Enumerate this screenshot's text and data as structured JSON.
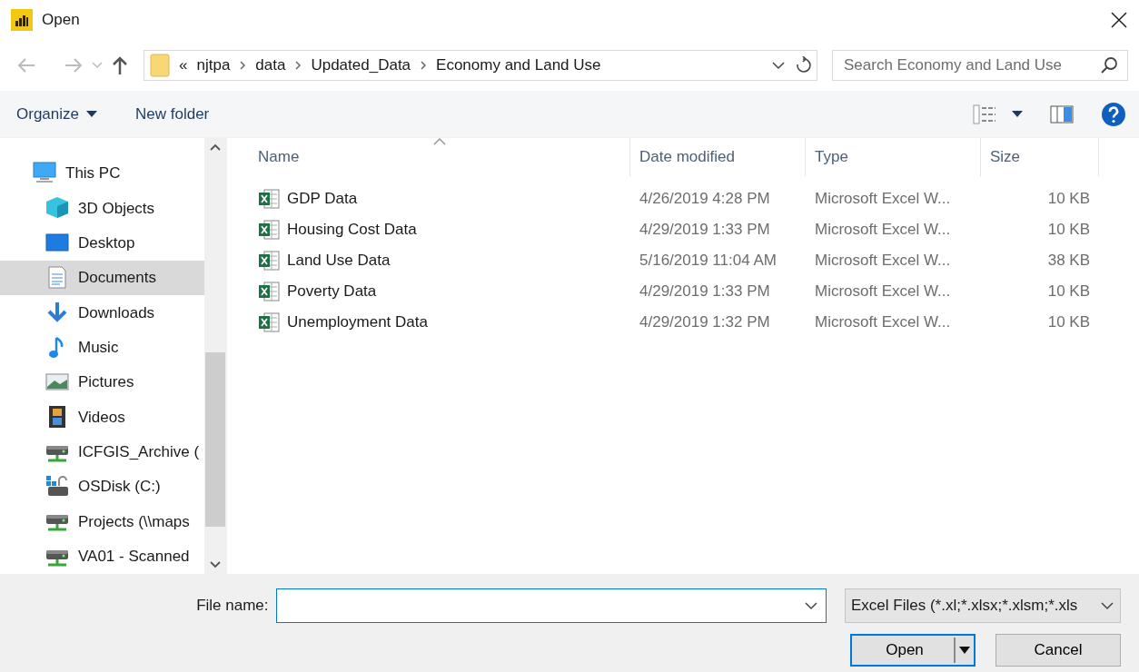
{
  "window": {
    "title": "Open"
  },
  "address_bar": {
    "overflow": "«",
    "crumbs": [
      "njtpa",
      "data",
      "Updated_Data",
      "Economy and Land Use"
    ]
  },
  "search": {
    "placeholder": "Search Economy and Land Use"
  },
  "toolbar": {
    "buttons": [
      {
        "label": "Organize",
        "kind": "menu"
      },
      {
        "label": "New folder",
        "kind": "plain"
      }
    ]
  },
  "sidebar": {
    "items": [
      {
        "label": "This PC",
        "kind": "pc",
        "selected": false,
        "children": [
          {
            "label": "3D Objects",
            "kind": "cube",
            "selected": false
          },
          {
            "label": "Desktop",
            "kind": "desktop",
            "selected": false
          },
          {
            "label": "Documents",
            "kind": "documents",
            "selected": true
          },
          {
            "label": "Downloads",
            "kind": "downloads",
            "selected": false
          },
          {
            "label": "Music",
            "kind": "music",
            "selected": false
          },
          {
            "label": "Pictures",
            "kind": "pictures",
            "selected": false
          },
          {
            "label": "Videos",
            "kind": "videos",
            "selected": false
          },
          {
            "label": "ICFGIS_Archive (",
            "kind": "netdrive",
            "selected": false
          },
          {
            "label": "OSDisk (C:)",
            "kind": "osdisk",
            "selected": false
          },
          {
            "label": "Projects (\\\\maps",
            "kind": "netdrive",
            "selected": false
          },
          {
            "label": "VA01 - Scanned",
            "kind": "netdrive",
            "selected": false
          }
        ]
      }
    ]
  },
  "table": {
    "columns": [
      {
        "label": "Name",
        "sorted": true
      },
      {
        "label": "Date modified",
        "sorted": false
      },
      {
        "label": "Type",
        "sorted": false
      },
      {
        "label": "Size",
        "sorted": false
      }
    ],
    "rows": [
      {
        "name": "GDP Data",
        "date": "4/26/2019 4:28 PM",
        "type": "Microsoft Excel W...",
        "size": "10 KB"
      },
      {
        "name": "Housing Cost Data",
        "date": "4/29/2019 1:33 PM",
        "type": "Microsoft Excel W...",
        "size": "10 KB"
      },
      {
        "name": "Land Use Data",
        "date": "5/16/2019 11:04 AM",
        "type": "Microsoft Excel W...",
        "size": "38 KB"
      },
      {
        "name": "Poverty Data",
        "date": "4/29/2019 1:33 PM",
        "type": "Microsoft Excel W...",
        "size": "10 KB"
      },
      {
        "name": "Unemployment Data",
        "date": "4/29/2019 1:32 PM",
        "type": "Microsoft Excel W...",
        "size": "10 KB"
      }
    ]
  },
  "footer": {
    "file_name_label": "File name:",
    "file_type": "Excel Files (*.xl;*.xlsx;*.xlsm;*.xls",
    "buttons": [
      {
        "label": "Open",
        "kind": "split"
      },
      {
        "label": "Cancel",
        "kind": "plain"
      }
    ]
  }
}
